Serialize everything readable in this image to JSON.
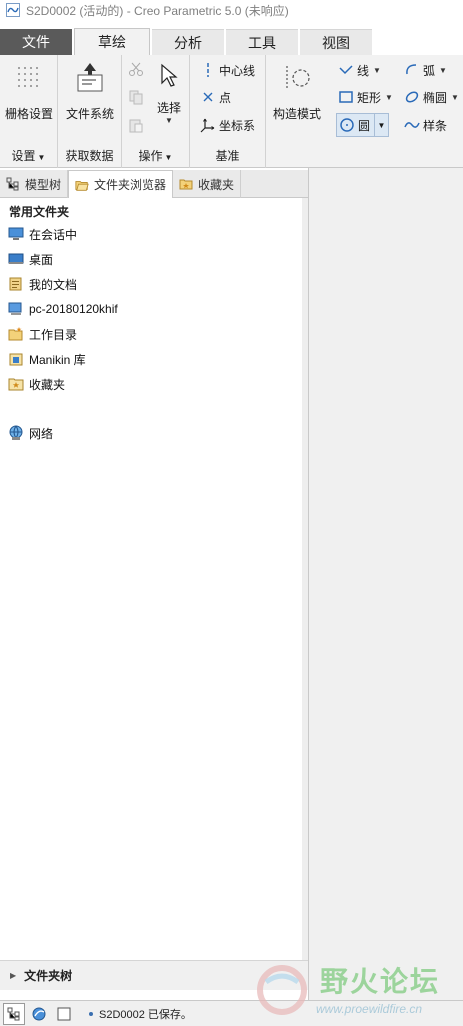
{
  "window": {
    "title": "S2D0002 (活动的) - Creo Parametric 5.0 (未响应)"
  },
  "tabs": [
    {
      "label": "文件"
    },
    {
      "label": "草绘"
    },
    {
      "label": "分析"
    },
    {
      "label": "工具"
    },
    {
      "label": "视图"
    }
  ],
  "ribbon": {
    "settings": {
      "group_label": "设置",
      "grid": "栅格设置"
    },
    "get_data": {
      "group_label": "获取数据",
      "file_system": "文件系统"
    },
    "operations": {
      "group_label": "操作",
      "select": "选择"
    },
    "datum": {
      "group_label": "基准",
      "centerline": "中心线",
      "point": "点",
      "coord_sys": "坐标系"
    },
    "construct": {
      "mode": "构造模式"
    },
    "sketch": {
      "line": "线",
      "arc": "弧",
      "rectangle": "矩形",
      "ellipse": "椭圆",
      "circle": "圆",
      "spline": "样条"
    }
  },
  "panel_tabs": [
    {
      "label": "模型树"
    },
    {
      "label": "文件夹浏览器"
    },
    {
      "label": "收藏夹"
    }
  ],
  "browser": {
    "section_title": "常用文件夹",
    "items": [
      {
        "label": "在会话中"
      },
      {
        "label": "桌面"
      },
      {
        "label": "我的文档"
      },
      {
        "label": "pc-20180120khif"
      },
      {
        "label": "工作目录"
      },
      {
        "label": "Manikin 库"
      },
      {
        "label": "收藏夹"
      },
      {
        "label": "网络"
      }
    ],
    "folder_tree": "文件夹树"
  },
  "status": {
    "message": "S2D0002 已保存。"
  },
  "watermark": {
    "title": "野火论坛",
    "url": "www.proewildfire.cn"
  },
  "colors": {
    "file_tab": "#5a5a5a",
    "ribbon_bg": "#f2f2f2",
    "accent_blue": "#2a6ab8"
  }
}
